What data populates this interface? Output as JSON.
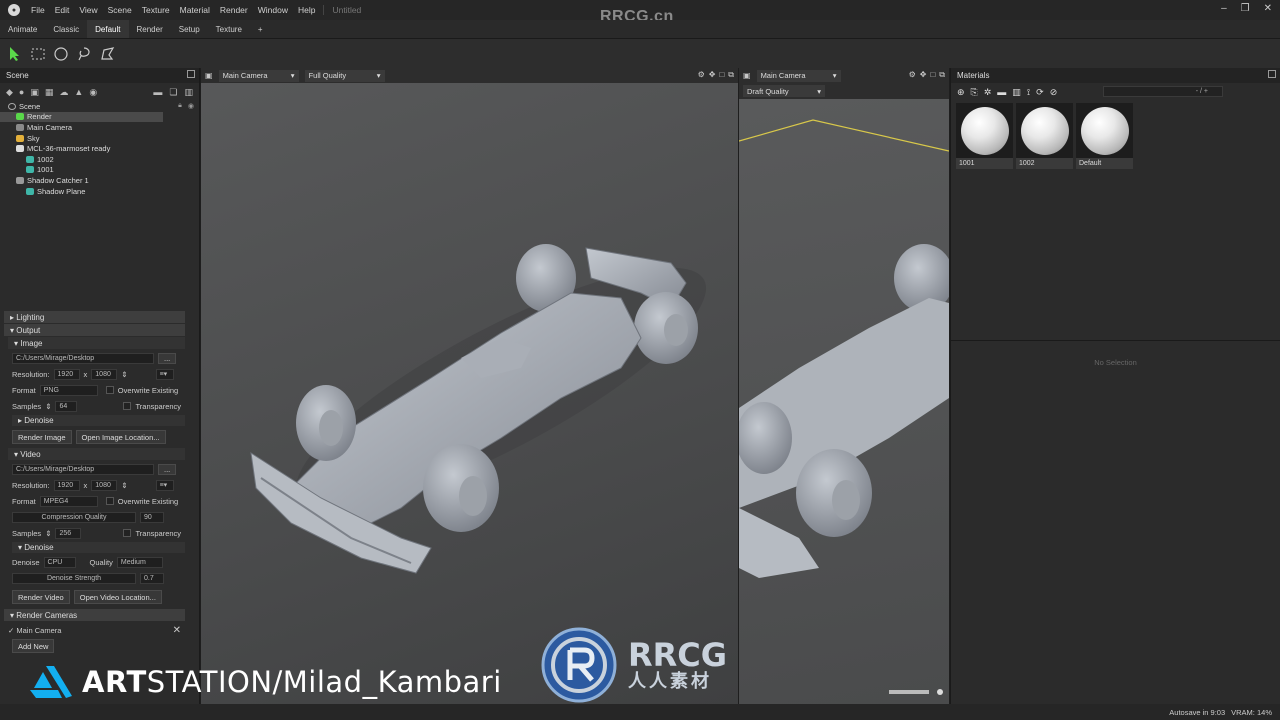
{
  "app": {
    "menu": [
      "File",
      "Edit",
      "View",
      "Scene",
      "Texture",
      "Material",
      "Render",
      "Window",
      "Help"
    ],
    "doc_title": "Untitled",
    "watermark": "RRCG.cn"
  },
  "workspace_tabs": [
    "Animate",
    "Classic",
    "Default",
    "Render",
    "Setup",
    "Texture",
    "+"
  ],
  "scene": {
    "title": "Scene",
    "tree": [
      {
        "label": "Scene",
        "indent": 0
      },
      {
        "label": "Render",
        "indent": 1,
        "selected": true
      },
      {
        "label": "Main Camera",
        "indent": 1
      },
      {
        "label": "Sky",
        "indent": 1
      },
      {
        "label": "MCL-36-marmoset ready",
        "indent": 1
      },
      {
        "label": "1002",
        "indent": 2
      },
      {
        "label": "1001",
        "indent": 2
      },
      {
        "label": "Shadow Catcher 1",
        "indent": 1
      },
      {
        "label": "Shadow Plane",
        "indent": 2
      }
    ]
  },
  "render_settings": {
    "lighting": "Lighting",
    "output": "Output",
    "image": {
      "title": "Image",
      "path": "C:/Users/Mirage/Desktop",
      "browse": "...",
      "resolution_label": "Resolution:",
      "res_w": "1920",
      "res_x": "x",
      "res_h": "1080",
      "format_label": "Format",
      "format": "PNG",
      "overwrite": "Overwrite Existing",
      "samples_label": "Samples",
      "samples": "64",
      "transparency": "Transparency",
      "denoise": "Denoise",
      "render_btn": "Render Image",
      "open_btn": "Open Image Location..."
    },
    "video": {
      "title": "Video",
      "path": "C:/Users/Mirage/Desktop",
      "browse": "...",
      "resolution_label": "Resolution:",
      "res_w": "1920",
      "res_x": "x",
      "res_h": "1080",
      "format_label": "Format",
      "format": "MPEG4",
      "overwrite": "Overwrite Existing",
      "compression_label": "Compression Quality",
      "compression": "90",
      "samples_label": "Samples",
      "samples": "256",
      "transparency": "Transparency",
      "denoise_title": "Denoise",
      "denoise_label": "Denoise",
      "denoise_device": "CPU",
      "quality_label": "Quality",
      "quality": "Medium",
      "strength_label": "Denoise Strength",
      "strength": "0.7",
      "render_btn": "Render Video",
      "open_btn": "Open Video Location..."
    },
    "render_cameras": "Render Cameras",
    "camera_item": "Main Camera",
    "add_new": "Add New"
  },
  "viewport_main": {
    "camera": "Main Camera",
    "quality": "Full Quality"
  },
  "viewport_side": {
    "camera": "Main Camera",
    "quality": "Draft Quality"
  },
  "materials": {
    "title": "Materials",
    "search_value": "- / +",
    "items": [
      "1001",
      "1002",
      "Default"
    ],
    "no_selection": "No Selection"
  },
  "status": {
    "autosave": "Autosave in 9:03",
    "vram": "VRAM: 14%"
  },
  "overlay": {
    "artstation_prefix": "ART",
    "artstation_rest": "STATION/Milad_Kambari",
    "rrcg": "RRCG",
    "rrcg_sub": "人人素材"
  },
  "colors": {
    "accent": "#4a90d9",
    "selected_row": "#4a4a4a"
  }
}
